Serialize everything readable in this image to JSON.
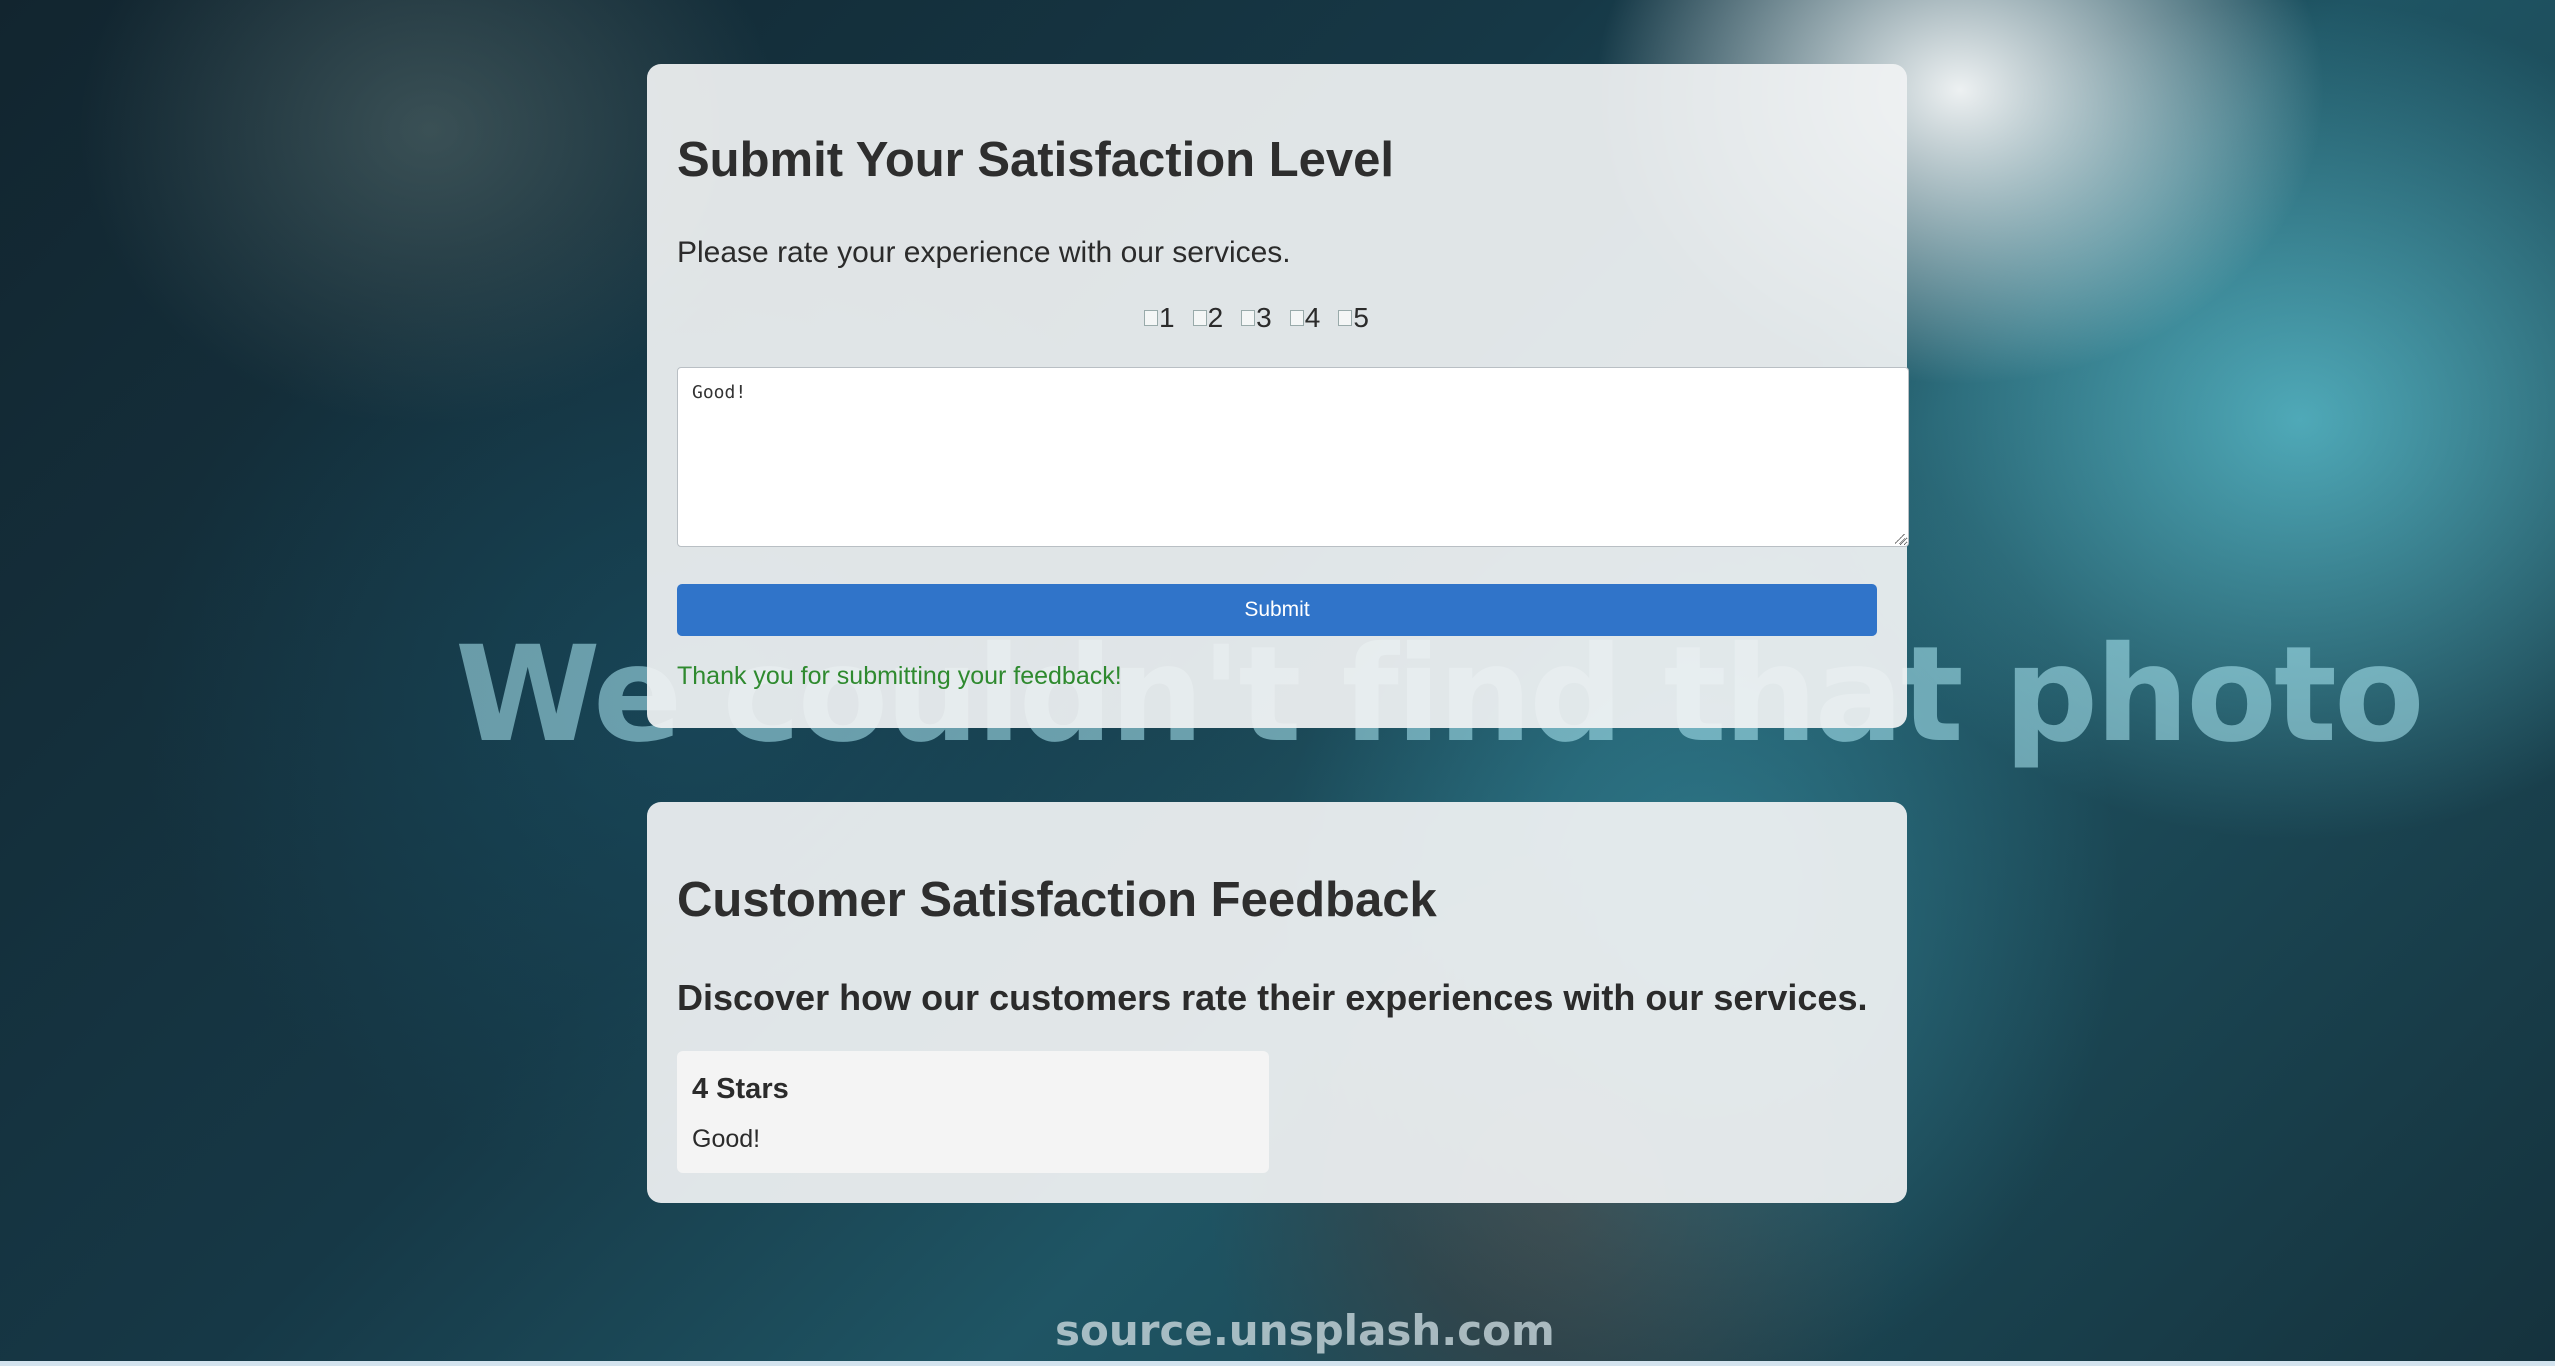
{
  "background": {
    "watermark_text": "We couldn't find that photo",
    "source_text": "source.unsplash.com"
  },
  "submit_form": {
    "title": "Submit Your Satisfaction Level",
    "intro": "Please rate your experience with our services.",
    "rating_options": [
      "1",
      "2",
      "3",
      "4",
      "5"
    ],
    "feedback_value": "Good!",
    "submit_label": "Submit",
    "confirmation": "Thank you for submitting your feedback!",
    "accent_color": "#3074c9",
    "confirmation_color": "#2f8a2f"
  },
  "feedback_section": {
    "title": "Customer Satisfaction Feedback",
    "subtitle": "Discover how our customers rate their experiences with our services.",
    "reviews": [
      {
        "rating": "4 Stars",
        "comment": "Good!"
      }
    ]
  }
}
